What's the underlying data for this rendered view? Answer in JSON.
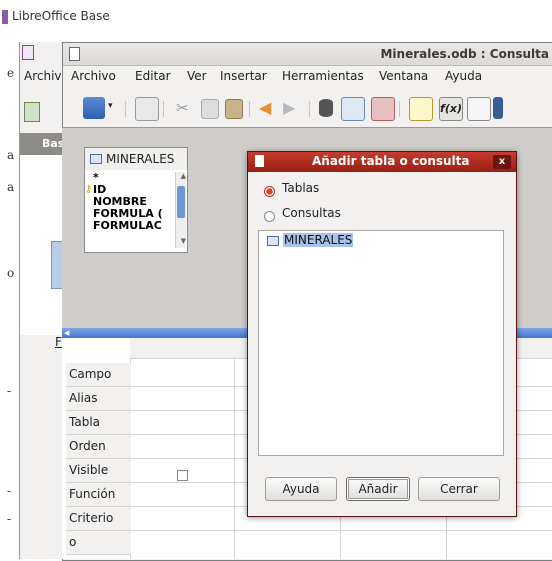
{
  "app_caption": "LibreOffice Base",
  "back_window": {
    "menu_first": "Archiv",
    "sidebar_heading": "Bas",
    "form_fragment": "Fo"
  },
  "window": {
    "title": "Minerales.odb : Consulta",
    "menu": [
      "Archivo",
      "Editar",
      "Ver",
      "Insertar",
      "Herramientas",
      "Ventana",
      "Ayuda"
    ],
    "toolbar_icons": [
      "new-document-icon",
      "save-icon",
      "edit-icon",
      "cut-icon",
      "copy-icon",
      "paste-icon",
      "undo-icon",
      "redo-icon",
      "database-icon",
      "table-design-icon",
      "view-icon",
      "add-table-icon",
      "function-icon",
      "alias-icon",
      "distinct-icon"
    ]
  },
  "table_box": {
    "name": "MINERALES",
    "fields": [
      "*",
      "ID",
      "NOMBRE",
      "FORMULA (",
      "FORMULAC"
    ]
  },
  "grid": {
    "rows": [
      "Campo",
      "Alias",
      "Tabla",
      "Orden",
      "Visible",
      "Función",
      "Criterio",
      "o"
    ]
  },
  "dialog": {
    "title": "Añadir tabla o consulta",
    "close_label": "x",
    "option_tables": "Tablas",
    "option_queries": "Consultas",
    "selected_option": "Tablas",
    "list_items": [
      "MINERALES"
    ],
    "buttons": {
      "help": "Ayuda",
      "add": "Añadir",
      "close": "Cerrar"
    }
  }
}
